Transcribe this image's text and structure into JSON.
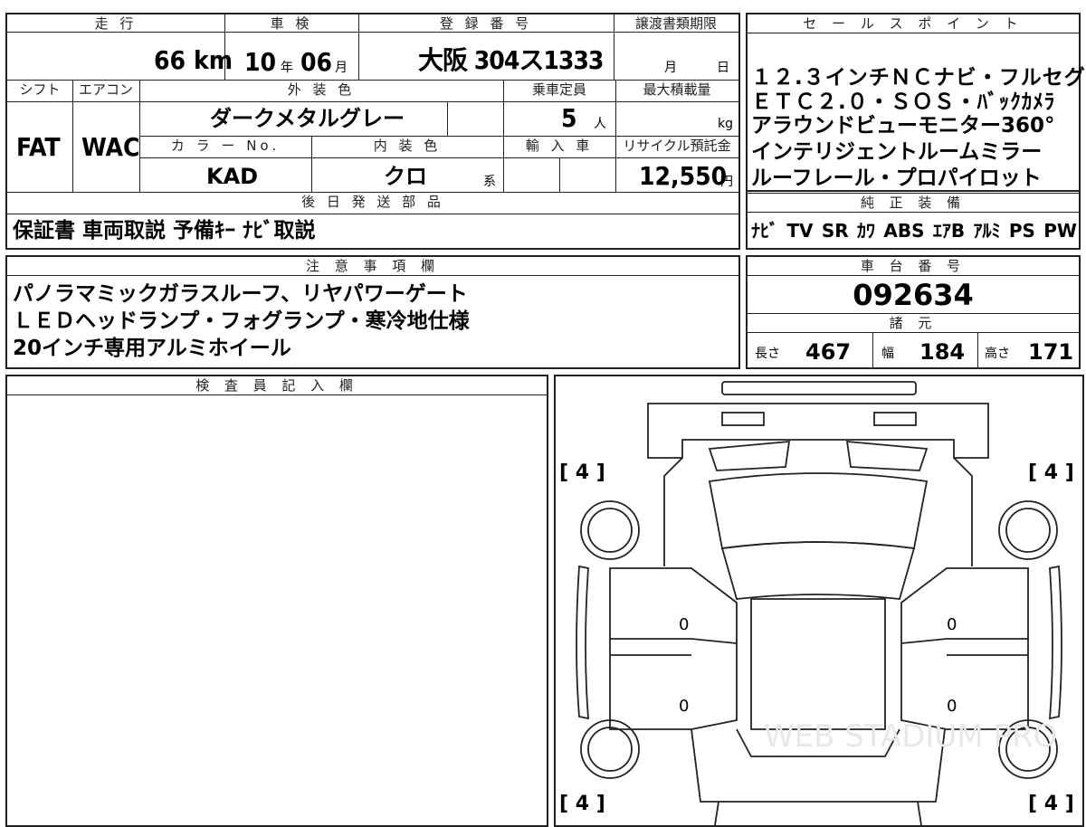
{
  "sheet": {
    "mileage": {
      "label": "走 行",
      "value": "66",
      "unit": "km"
    },
    "inspection": {
      "label": "車 検",
      "year": "10",
      "year_unit": "年",
      "month": "06",
      "month_unit": "月"
    },
    "registration": {
      "label": "登 録 番 号",
      "value": "大阪 304ス1333"
    },
    "transfer_deadline": {
      "label": "譲渡書類期限",
      "month_unit": "月",
      "day_unit": "日"
    },
    "shift": {
      "label": "シフト",
      "value": "FAT"
    },
    "aircon": {
      "label": "エアコン",
      "value": "WAC"
    },
    "exterior_color": {
      "label": "外 装 色",
      "value": "ダークメタルグレー"
    },
    "capacity": {
      "label": "乗車定員",
      "value": "5",
      "unit": "人"
    },
    "max_load": {
      "label": "最大積載量",
      "unit": "kg"
    },
    "color_no": {
      "label": "カ ラ ー No.",
      "value": "KAD"
    },
    "interior_color": {
      "label": "内 装 色",
      "value": "クロ",
      "suffix": "系"
    },
    "import": {
      "label": "輸 入 車"
    },
    "recycle_fee": {
      "label": "リサイクル預託金",
      "value": "12,550",
      "unit": "円"
    },
    "later_parts": {
      "label": "後 日 発 送 部 品",
      "value": "保証書 車両取説 予備ｷｰ ﾅﾋﾞ取説"
    },
    "notes": {
      "label": "注 意 事 項 欄",
      "lines": [
        "パノラマミックガラスルーフ、リヤパワーゲート",
        "ＬＥＤヘッドランプ・フォグランプ・寒冷地仕様",
        "20インチ専用アルミホイール"
      ]
    },
    "inspector": {
      "label": "検 査 員 記 入 欄"
    },
    "sales_points": {
      "label": "セ ー ル ス ポ イ ン ト",
      "lines": [
        "１２.３インチＮＣナビ・フルセグ",
        "ＥＴＣ２.０・ＳＯＳ・ﾊﾞｯｸｶﾒﾗ",
        "アラウンドビューモニター360°",
        "インテリジェントルームミラー",
        "ルーフレール・プロパイロット"
      ]
    },
    "equipment": {
      "label": "純 正 装 備",
      "items": [
        "ﾅﾋﾞ",
        "TV",
        "SR",
        "ｶﾜ",
        "ABS",
        "ｴｱB",
        "ｱﾙﾐ",
        "PS",
        "PW"
      ]
    },
    "chassis": {
      "label": "車 台 番 号",
      "value": "092634"
    },
    "specs": {
      "label": "諸 元",
      "length_label": "長さ",
      "length": "467",
      "width_label": "幅",
      "width": "184",
      "height_label": "高さ",
      "height": "171"
    },
    "diagram": {
      "tire_fl": "4",
      "tire_fr": "4",
      "tire_rl": "4",
      "tire_rr": "4",
      "door_marks": [
        "0",
        "0",
        "0",
        "0"
      ],
      "watermark": "WEB STADIUM PRO"
    }
  }
}
